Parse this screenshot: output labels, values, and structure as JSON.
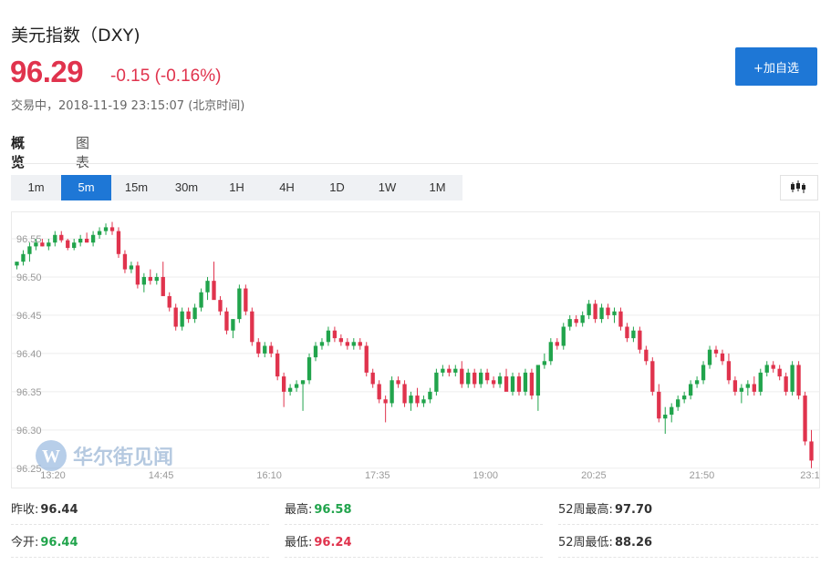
{
  "header": {
    "title": "美元指数（DXY)",
    "price": "96.29",
    "change": "-0.15 (-0.16%)",
    "status": "交易中，2018-11-19 23:15:07 (北京时间)",
    "add_label": "+加自选"
  },
  "tabs": [
    {
      "label": "概览",
      "active": true
    },
    {
      "label": "图表",
      "active": false
    }
  ],
  "timeframes": [
    {
      "label": "1m",
      "active": false
    },
    {
      "label": "5m",
      "active": true
    },
    {
      "label": "15m",
      "active": false
    },
    {
      "label": "30m",
      "active": false
    },
    {
      "label": "1H",
      "active": false
    },
    {
      "label": "4H",
      "active": false
    },
    {
      "label": "1D",
      "active": false
    },
    {
      "label": "1W",
      "active": false
    },
    {
      "label": "1M",
      "active": false
    }
  ],
  "icons": {
    "chart_type": "candlestick-icon",
    "logo": "wallstreetcn-logo"
  },
  "colors": {
    "up": "#21a44c",
    "down": "#e0334d",
    "accent": "#1e77d6"
  },
  "watermark": "华尔街见闻",
  "chart_data": {
    "type": "candlestick",
    "ylim": [
      96.245,
      96.575
    ],
    "y_ticks": [
      "96.25",
      "96.30",
      "96.35",
      "96.40",
      "96.45",
      "96.50",
      "96.55"
    ],
    "x_ticks": [
      "13:20",
      "14:45",
      "16:10",
      "17:35",
      "19:00",
      "20:25",
      "21:50",
      "23:1"
    ],
    "grid": true,
    "ohlc": [
      [
        96.515,
        96.52,
        96.51,
        96.52
      ],
      [
        96.52,
        96.535,
        96.515,
        96.53
      ],
      [
        96.53,
        96.545,
        96.52,
        96.54
      ],
      [
        96.54,
        96.55,
        96.535,
        96.545
      ],
      [
        96.545,
        96.55,
        96.54,
        96.54
      ],
      [
        96.54,
        96.55,
        96.535,
        96.545
      ],
      [
        96.545,
        96.56,
        96.54,
        96.555
      ],
      [
        96.555,
        96.56,
        96.545,
        96.548
      ],
      [
        96.548,
        96.55,
        96.535,
        96.538
      ],
      [
        96.538,
        96.55,
        96.535,
        96.545
      ],
      [
        96.545,
        96.555,
        96.54,
        96.55
      ],
      [
        96.55,
        96.558,
        96.545,
        96.545
      ],
      [
        96.545,
        96.56,
        96.54,
        96.555
      ],
      [
        96.555,
        96.565,
        96.55,
        96.56
      ],
      [
        96.56,
        96.57,
        96.555,
        96.565
      ],
      [
        96.565,
        96.572,
        96.555,
        96.56
      ],
      [
        96.56,
        96.565,
        96.525,
        96.53
      ],
      [
        96.53,
        96.535,
        96.505,
        96.51
      ],
      [
        96.51,
        96.52,
        96.505,
        96.515
      ],
      [
        96.515,
        96.52,
        96.485,
        96.49
      ],
      [
        96.49,
        96.505,
        96.48,
        96.5
      ],
      [
        96.5,
        96.51,
        96.49,
        96.495
      ],
      [
        96.495,
        96.505,
        96.49,
        96.5
      ],
      [
        96.5,
        96.52,
        96.49,
        96.475
      ],
      [
        96.475,
        96.48,
        96.455,
        96.46
      ],
      [
        96.46,
        96.465,
        96.43,
        96.435
      ],
      [
        96.435,
        96.46,
        96.43,
        96.455
      ],
      [
        96.455,
        96.46,
        96.44,
        96.445
      ],
      [
        96.445,
        96.465,
        96.44,
        96.46
      ],
      [
        96.46,
        96.485,
        96.455,
        96.48
      ],
      [
        96.48,
        96.5,
        96.47,
        96.495
      ],
      [
        96.495,
        96.52,
        96.48,
        96.47
      ],
      [
        96.47,
        96.475,
        96.45,
        96.455
      ],
      [
        96.455,
        96.46,
        96.425,
        96.43
      ],
      [
        96.43,
        96.435,
        96.42,
        96.445
      ],
      [
        96.445,
        96.49,
        96.44,
        96.485
      ],
      [
        96.485,
        96.49,
        96.45,
        96.455
      ],
      [
        96.455,
        96.46,
        96.41,
        96.415
      ],
      [
        96.415,
        96.42,
        96.395,
        96.4
      ],
      [
        96.4,
        96.415,
        96.395,
        96.41
      ],
      [
        96.41,
        96.415,
        96.395,
        96.4
      ],
      [
        96.4,
        96.405,
        96.365,
        96.37
      ],
      [
        96.37,
        96.375,
        96.33,
        96.35
      ],
      [
        96.35,
        96.36,
        96.345,
        96.355
      ],
      [
        96.355,
        96.365,
        96.35,
        96.36
      ],
      [
        96.36,
        96.365,
        96.325,
        96.365
      ],
      [
        96.365,
        96.4,
        96.36,
        96.395
      ],
      [
        96.395,
        96.415,
        96.39,
        96.41
      ],
      [
        96.41,
        96.42,
        96.405,
        96.415
      ],
      [
        96.415,
        96.435,
        96.41,
        96.43
      ],
      [
        96.43,
        96.435,
        96.415,
        96.42
      ],
      [
        96.42,
        96.425,
        96.41,
        96.415
      ],
      [
        96.415,
        96.42,
        96.405,
        96.41
      ],
      [
        96.41,
        96.42,
        96.405,
        96.415
      ],
      [
        96.415,
        96.42,
        96.405,
        96.41
      ],
      [
        96.41,
        96.415,
        96.37,
        96.375
      ],
      [
        96.375,
        96.38,
        96.355,
        96.36
      ],
      [
        96.36,
        96.365,
        96.335,
        96.34
      ],
      [
        96.34,
        96.345,
        96.31,
        96.335
      ],
      [
        96.335,
        96.37,
        96.33,
        96.365
      ],
      [
        96.365,
        96.37,
        96.355,
        96.36
      ],
      [
        96.36,
        96.365,
        96.33,
        96.335
      ],
      [
        96.335,
        96.35,
        96.325,
        96.345
      ],
      [
        96.345,
        96.355,
        96.33,
        96.335
      ],
      [
        96.335,
        96.345,
        96.33,
        96.34
      ],
      [
        96.34,
        96.355,
        96.335,
        96.35
      ],
      [
        96.35,
        96.38,
        96.345,
        96.375
      ],
      [
        96.375,
        96.385,
        96.37,
        96.38
      ],
      [
        96.38,
        96.385,
        96.37,
        96.375
      ],
      [
        96.375,
        96.385,
        96.37,
        96.38
      ],
      [
        96.38,
        96.39,
        96.355,
        96.36
      ],
      [
        96.36,
        96.38,
        96.355,
        96.375
      ],
      [
        96.375,
        96.38,
        96.355,
        96.36
      ],
      [
        96.36,
        96.38,
        96.355,
        96.375
      ],
      [
        96.375,
        96.38,
        96.36,
        96.365
      ],
      [
        96.365,
        96.37,
        96.355,
        96.36
      ],
      [
        96.36,
        96.375,
        96.355,
        96.37
      ],
      [
        96.37,
        96.38,
        96.36,
        96.35
      ],
      [
        96.35,
        96.375,
        96.345,
        96.37
      ],
      [
        96.37,
        96.375,
        96.345,
        96.35
      ],
      [
        96.35,
        96.38,
        96.345,
        96.375
      ],
      [
        96.375,
        96.38,
        96.34,
        96.345
      ],
      [
        96.345,
        96.35,
        96.325,
        96.385
      ],
      [
        96.385,
        96.4,
        96.38,
        96.39
      ],
      [
        96.39,
        96.42,
        96.385,
        96.415
      ],
      [
        96.415,
        96.42,
        96.405,
        96.41
      ],
      [
        96.41,
        96.44,
        96.405,
        96.435
      ],
      [
        96.435,
        96.45,
        96.43,
        96.445
      ],
      [
        96.445,
        96.45,
        96.435,
        96.44
      ],
      [
        96.44,
        96.455,
        96.435,
        96.45
      ],
      [
        96.45,
        96.47,
        96.445,
        96.465
      ],
      [
        96.465,
        96.47,
        96.44,
        96.445
      ],
      [
        96.445,
        96.465,
        96.44,
        96.46
      ],
      [
        96.46,
        96.465,
        96.445,
        96.45
      ],
      [
        96.45,
        96.46,
        96.44,
        96.455
      ],
      [
        96.455,
        96.46,
        96.43,
        96.435
      ],
      [
        96.435,
        96.44,
        96.415,
        96.42
      ],
      [
        96.42,
        96.435,
        96.415,
        96.43
      ],
      [
        96.43,
        96.435,
        96.4,
        96.405
      ],
      [
        96.405,
        96.41,
        96.385,
        96.39
      ],
      [
        96.39,
        96.395,
        96.345,
        96.35
      ],
      [
        96.35,
        96.36,
        96.31,
        96.315
      ],
      [
        96.315,
        96.33,
        96.295,
        96.32
      ],
      [
        96.32,
        96.335,
        96.31,
        96.33
      ],
      [
        96.33,
        96.345,
        96.325,
        96.34
      ],
      [
        96.34,
        96.35,
        96.335,
        96.345
      ],
      [
        96.345,
        96.365,
        96.34,
        96.36
      ],
      [
        96.36,
        96.37,
        96.355,
        96.365
      ],
      [
        96.365,
        96.39,
        96.36,
        96.385
      ],
      [
        96.385,
        96.41,
        96.38,
        96.405
      ],
      [
        96.405,
        96.41,
        96.395,
        96.4
      ],
      [
        96.4,
        96.405,
        96.385,
        96.39
      ],
      [
        96.39,
        96.4,
        96.36,
        96.365
      ],
      [
        96.365,
        96.37,
        96.345,
        96.35
      ],
      [
        96.35,
        96.36,
        96.335,
        96.355
      ],
      [
        96.355,
        96.365,
        96.345,
        96.36
      ],
      [
        96.36,
        96.37,
        96.345,
        96.35
      ],
      [
        96.35,
        96.38,
        96.345,
        96.375
      ],
      [
        96.375,
        96.39,
        96.37,
        96.385
      ],
      [
        96.385,
        96.39,
        96.375,
        96.38
      ],
      [
        96.38,
        96.385,
        96.365,
        96.37
      ],
      [
        96.37,
        96.375,
        96.345,
        96.35
      ],
      [
        96.35,
        96.39,
        96.345,
        96.385
      ],
      [
        96.385,
        96.39,
        96.34,
        96.345
      ],
      [
        96.345,
        96.35,
        96.28,
        96.285
      ],
      [
        96.285,
        96.3,
        96.25,
        96.26
      ]
    ]
  },
  "stats": [
    {
      "label": "昨收:",
      "value": "96.44",
      "color": "#333333"
    },
    {
      "label": "最高:",
      "value": "96.58",
      "color": "#21a44c"
    },
    {
      "label": "52周最高:",
      "value": "97.70",
      "color": "#333333"
    },
    {
      "label": "今开:",
      "value": "96.44",
      "color": "#21a44c"
    },
    {
      "label": "最低:",
      "value": "96.24",
      "color": "#e0334d"
    },
    {
      "label": "52周最低:",
      "value": "88.26",
      "color": "#333333"
    }
  ]
}
